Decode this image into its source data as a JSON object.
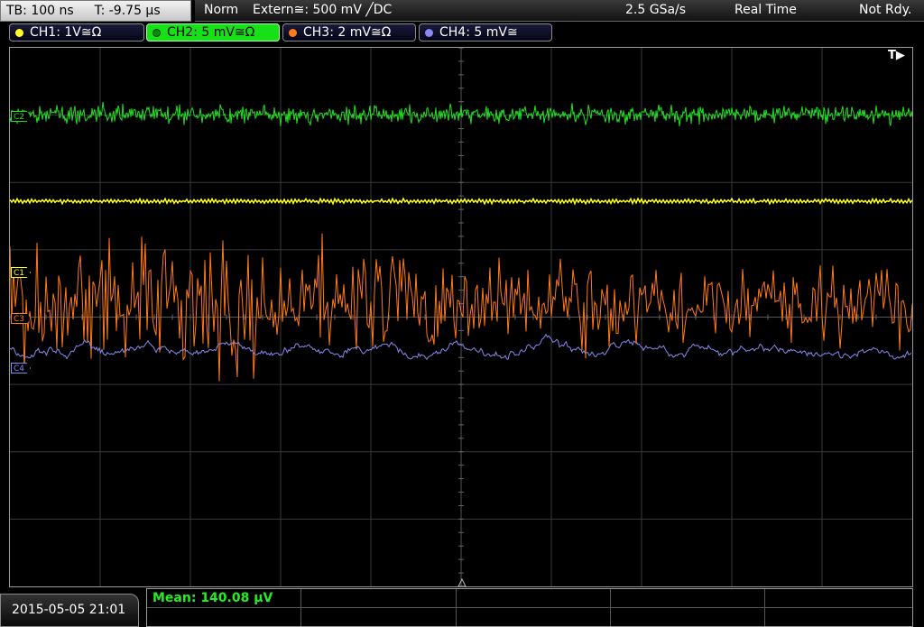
{
  "top_bar": {
    "timebase": "TB: 100 ns",
    "trigger_time": "T: -9.75 µs",
    "trigger_mode": "Norm",
    "trigger_source": "Extern≅: 500 mV ╱DC",
    "sample_rate": "2.5 GSa/s",
    "acquisition_mode": "Real Time",
    "status": "Not Rdy."
  },
  "channels": [
    {
      "label": "CH1: 1V≅Ω",
      "color": "#ffff20",
      "active": false,
      "marker": "C1"
    },
    {
      "label": "CH2: 5 mV≅Ω",
      "color": "#22e022",
      "active": true,
      "marker": "C2"
    },
    {
      "label": "CH3: 2 mV≅Ω",
      "color": "#ff7a1a",
      "active": false,
      "marker": "C3"
    },
    {
      "label": "CH4: 5 mV≅",
      "color": "#8888ee",
      "active": false,
      "marker": "C4"
    }
  ],
  "trigger_indicator": "T▶",
  "datetime": "2015-05-05 21:01",
  "measurement": {
    "mean": "Mean: 140.08 µV"
  },
  "colors": {
    "ch1": "#ffff20",
    "ch2": "#22e022",
    "ch3": "#ff7a1a",
    "ch4": "#8888ee",
    "grid": "#3a3a3a"
  }
}
